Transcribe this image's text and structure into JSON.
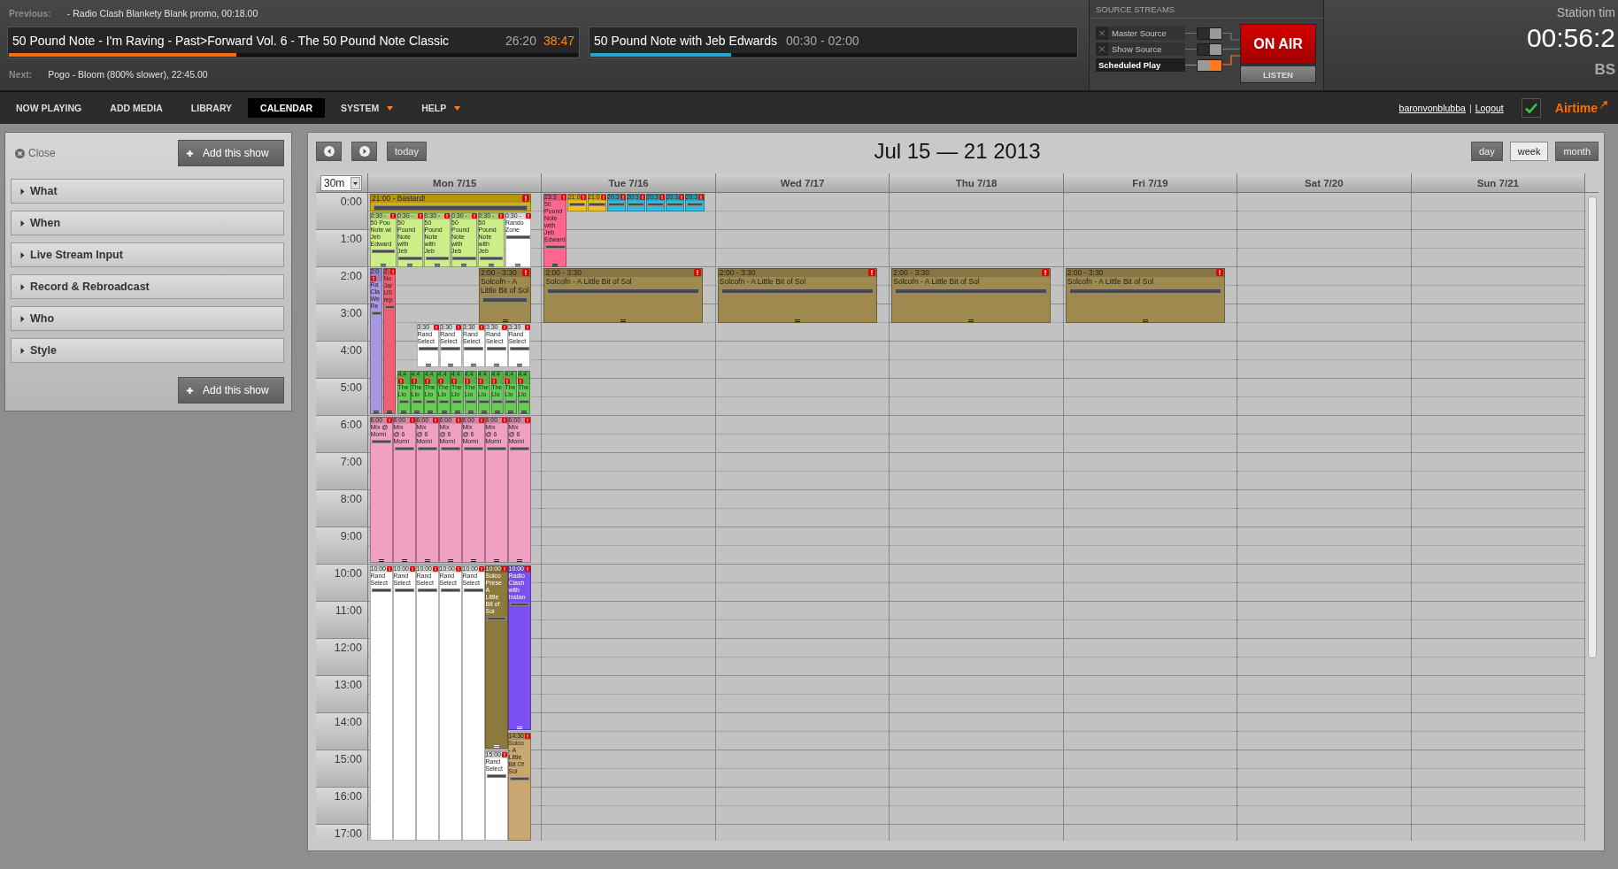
{
  "now_playing": {
    "previous": {
      "label": "Previous:",
      "value": "- Radio Clash Blankety Blank promo, 00:18.00"
    },
    "current_track": {
      "title": "50 Pound Note - I'm Raving - Past>Forward Vol. 6 - The 50 Pound Note Classic",
      "elapsed": "26:20",
      "remaining": "38:47",
      "level": 0.4
    },
    "current_show": {
      "title": "50 Pound Note with Jeb Edwards",
      "time": "00:30 - 02:00",
      "level": 0.29
    },
    "next": {
      "label": "Next:",
      "value": "Pogo - Bloom (800% slower), 22:45.00"
    }
  },
  "source_streams": {
    "title": "SOURCE STREAMS",
    "sources": [
      {
        "label": "Master Source",
        "disconnect_button": true,
        "on": false
      },
      {
        "label": "Show Source",
        "disconnect_button": true,
        "on": false
      },
      {
        "label": "Scheduled Play",
        "disconnect_button": false,
        "on": true
      }
    ],
    "on_air": {
      "label": "ON AIR",
      "on": true
    },
    "listen": "LISTEN"
  },
  "station_time": {
    "label": "Station tim",
    "time": "00:56:2",
    "zone": "BS"
  },
  "nav": {
    "items": [
      {
        "label": "NOW PLAYING",
        "selected": false,
        "dropdown": false
      },
      {
        "label": "ADD MEDIA",
        "selected": false,
        "dropdown": false
      },
      {
        "label": "LIBRARY",
        "selected": false,
        "dropdown": false
      },
      {
        "label": "CALENDAR",
        "selected": true,
        "dropdown": false
      },
      {
        "label": "SYSTEM",
        "selected": false,
        "dropdown": true
      },
      {
        "label": "HELP",
        "selected": false,
        "dropdown": true
      }
    ]
  },
  "user": {
    "name": "baronvonblubba",
    "separator": "|",
    "logout": "Logout"
  },
  "logo": "Airtime",
  "add_show_panel": {
    "close": "Close",
    "add_button_top": "Add this show",
    "sections": [
      {
        "label": "What",
        "expanded": false
      },
      {
        "label": "When",
        "expanded": false
      },
      {
        "label": "Live Stream Input",
        "expanded": false
      },
      {
        "label": "Record & Rebroadcast",
        "expanded": false
      },
      {
        "label": "Who",
        "expanded": false
      },
      {
        "label": "Style",
        "expanded": false
      }
    ],
    "add_button_bottom": "Add this show"
  },
  "calendar": {
    "today": "today",
    "title": "Jul 15 — 21 2013",
    "views": [
      {
        "label": "day",
        "selected": false
      },
      {
        "label": "week",
        "selected": true
      },
      {
        "label": "month",
        "selected": false
      }
    ],
    "slot_size": "30m",
    "days": [
      {
        "label": "Mon 7/15",
        "events": [
          {
            "time": "21:00 - Bastard!",
            "color": "#d4ad0e",
            "alert": true
          },
          {
            "time": "0:30 -",
            "title_lines": [
              "50 Pou",
              "Note wi",
              "Jeb",
              "Edward"
            ],
            "color": "#ccee88",
            "alert": true
          },
          {
            "time": "0:30 -",
            "title_lines": [
              "50",
              "Pound",
              "Note",
              "with",
              "Jeb"
            ],
            "color": "#ccee88",
            "alert": true
          },
          {
            "time": "0:30 -",
            "title_lines": [
              "50",
              "Pound",
              "Note",
              "with",
              "Jeb"
            ],
            "color": "#ccee88",
            "alert": true
          },
          {
            "time": "0:30 -",
            "title_lines": [
              "50",
              "Pound",
              "Note",
              "with",
              "Jeb"
            ],
            "color": "#ccee88",
            "alert": true
          },
          {
            "time": "0:30 -",
            "title_lines": [
              "50",
              "Pound",
              "Note",
              "with",
              "Jeb"
            ],
            "color": "#ccee88",
            "alert": true
          },
          {
            "time": "0:30 -",
            "title_lines": [
              "Rando",
              "Zone"
            ],
            "color": "#ffffff",
            "alert": true
          },
          {
            "time": "2:0",
            "title_lines": [
              "Ra",
              "Cla",
              "We",
              "Re"
            ],
            "color": "#a898e0",
            "alert": true
          },
          {
            "time": "2:",
            "title_lines": [
              "No",
              "Jar",
              "US",
              "rep"
            ],
            "color": "#f06070",
            "alert": true
          },
          {
            "time": "2:00 - 3:30",
            "title_lines": [
              "Solcofn - A",
              "Little Bit of Sol"
            ],
            "color": "#9e8a4e",
            "alert": true
          },
          {
            "time": "3:30",
            "title_lines": [
              "Rand",
              "Select"
            ],
            "color": "#ffffff",
            "alert": true
          },
          {
            "time": "3:30",
            "title_lines": [
              "Rand",
              "Select"
            ],
            "color": "#ffffff",
            "alert": true
          },
          {
            "time": "3:30",
            "title_lines": [
              "Rand",
              "Select"
            ],
            "color": "#ffffff",
            "alert": true
          },
          {
            "time": "3:30",
            "title_lines": [
              "Rand",
              "Select"
            ],
            "color": "#ffffff",
            "alert": true
          },
          {
            "time": "3:30",
            "title_lines": [
              "Rand",
              "Select"
            ],
            "color": "#ffffff",
            "alert": true
          },
          {
            "time": "4:4",
            "title_lines": [
              "The",
              "Llo"
            ],
            "color": "#66cc55",
            "alert": true
          },
          {
            "time": "4:4",
            "title_lines": [
              "The",
              "Llo"
            ],
            "color": "#66cc55",
            "alert": true
          },
          {
            "time": "4:4",
            "title_lines": [
              "The",
              "Llo"
            ],
            "color": "#66cc55",
            "alert": true
          },
          {
            "time": "4:4",
            "title_lines": [
              "The",
              "Llo"
            ],
            "color": "#66cc55",
            "alert": true
          },
          {
            "time": "4:4",
            "title_lines": [
              "The",
              "Llo"
            ],
            "color": "#66cc55",
            "alert": true
          },
          {
            "time": "4:4",
            "title_lines": [
              "The",
              "Llo"
            ],
            "color": "#66cc55",
            "alert": true
          },
          {
            "time": "4:4",
            "title_lines": [
              "The",
              "Llo"
            ],
            "color": "#66cc55",
            "alert": true
          },
          {
            "time": "4:4",
            "title_lines": [
              "The",
              "Llo"
            ],
            "color": "#66cc55",
            "alert": true
          },
          {
            "time": "4:4",
            "title_lines": [
              "The",
              "Llo"
            ],
            "color": "#66cc55",
            "alert": true
          },
          {
            "time": "4:4",
            "title_lines": [
              "The",
              "Llo"
            ],
            "color": "#66cc55",
            "alert": true
          },
          {
            "time": "6:00",
            "title_lines": [
              "Mix @",
              "Morni"
            ],
            "color": "#f0a0c0",
            "alert": true
          },
          {
            "time": "6:00",
            "title_lines": [
              "Mix",
              "@ 6",
              "Morni"
            ],
            "color": "#f0a0c0",
            "alert": true
          },
          {
            "time": "6:00",
            "title_lines": [
              "Mix",
              "@ 6",
              "Morni"
            ],
            "color": "#f0a0c0",
            "alert": true
          },
          {
            "time": "6:00",
            "title_lines": [
              "Mix",
              "@ 6",
              "Morni"
            ],
            "color": "#f0a0c0",
            "alert": true
          },
          {
            "time": "6:00",
            "title_lines": [
              "Mix",
              "@ 6",
              "Morni"
            ],
            "color": "#f0a0c0",
            "alert": true
          },
          {
            "time": "6:00",
            "title_lines": [
              "Mix",
              "@ 6",
              "Morni"
            ],
            "color": "#f0a0c0",
            "alert": true
          },
          {
            "time": "6:00",
            "title_lines": [
              "Mix",
              "@ 6",
              "Morni"
            ],
            "color": "#f0a0c0",
            "alert": true
          },
          {
            "time": "10:00",
            "title_lines": [
              "Rand",
              "Select"
            ],
            "color": "#ffffff",
            "alert": true
          },
          {
            "time": "10:00",
            "title_lines": [
              "Rand",
              "Select"
            ],
            "color": "#ffffff",
            "alert": true
          },
          {
            "time": "10:00",
            "title_lines": [
              "Rand",
              "Select"
            ],
            "color": "#ffffff",
            "alert": true
          },
          {
            "time": "10:00",
            "title_lines": [
              "Rand",
              "Select"
            ],
            "color": "#ffffff",
            "alert": true
          },
          {
            "time": "10:00",
            "title_lines": [
              "Rand",
              "Select"
            ],
            "color": "#ffffff",
            "alert": true
          },
          {
            "time": "10:00",
            "title_lines": [
              "Solco",
              "Prese",
              "A",
              "Little",
              "Bit of",
              "Sol"
            ],
            "color": "#8c7a3c",
            "alert": true
          },
          {
            "time": "10:00",
            "title_lines": [
              "Radio",
              "Clash",
              "with",
              "Instan"
            ],
            "color": "#7b4ff0",
            "alert": true
          },
          {
            "time": "15:00",
            "title_lines": [
              "Rand",
              "Select"
            ],
            "color": "#ffffff",
            "alert": true
          },
          {
            "time": "14:30",
            "title_lines": [
              "Solco",
              "- A",
              "Little",
              "Bit Of",
              "Sol"
            ],
            "color": "#c8a870",
            "alert": true
          }
        ]
      },
      {
        "label": "Tue 7/16",
        "events": [
          {
            "time": "23:3",
            "title_lines": [
              "50",
              "Pound",
              "Note",
              "with",
              "Jeb",
              "Edward"
            ],
            "color": "#ff6690",
            "alert": true
          },
          {
            "time": "21:0",
            "color": "#f0c020",
            "alert": true
          },
          {
            "time": "21:0",
            "color": "#f0c020",
            "alert": true
          },
          {
            "time": "20:3",
            "color": "#33bbdd",
            "alert": true
          },
          {
            "time": "20:3",
            "color": "#33bbdd",
            "alert": true
          },
          {
            "time": "20:3",
            "color": "#33bbdd",
            "alert": true
          },
          {
            "time": "20:3",
            "color": "#33bbdd",
            "alert": true
          },
          {
            "time": "20:3",
            "color": "#33bbdd",
            "alert": true
          },
          {
            "time": "2:00 - 3:30",
            "title_lines": [
              "Solcofn - A Little Bit of Sol"
            ],
            "color": "#9e8a4e",
            "alert": true
          }
        ]
      },
      {
        "label": "Wed 7/17",
        "events": [
          {
            "time": "2:00 - 3:30",
            "title_lines": [
              "Solcofn - A Little Bit of Sol"
            ],
            "color": "#9e8a4e",
            "alert": true
          }
        ]
      },
      {
        "label": "Thu 7/18",
        "events": [
          {
            "time": "2:00 - 3:30",
            "title_lines": [
              "Solcofn - A Little Bit of Sol"
            ],
            "color": "#9e8a4e",
            "alert": true
          }
        ]
      },
      {
        "label": "Fri 7/19",
        "events": [
          {
            "time": "2:00 - 3:30",
            "title_lines": [
              "Solcofn - A Little Bit of Sol"
            ],
            "color": "#9e8a4e",
            "alert": true
          }
        ]
      },
      {
        "label": "Sat 7/20"
      },
      {
        "label": "Sun 7/21"
      }
    ],
    "hours": [
      "0:00",
      "1:00",
      "2:00",
      "3:00",
      "4:00",
      "5:00",
      "6:00",
      "7:00",
      "8:00",
      "9:00",
      "10:00",
      "11:00",
      "12:00",
      "13:00",
      "14:00",
      "15:00",
      "16:00",
      "17:00"
    ]
  }
}
